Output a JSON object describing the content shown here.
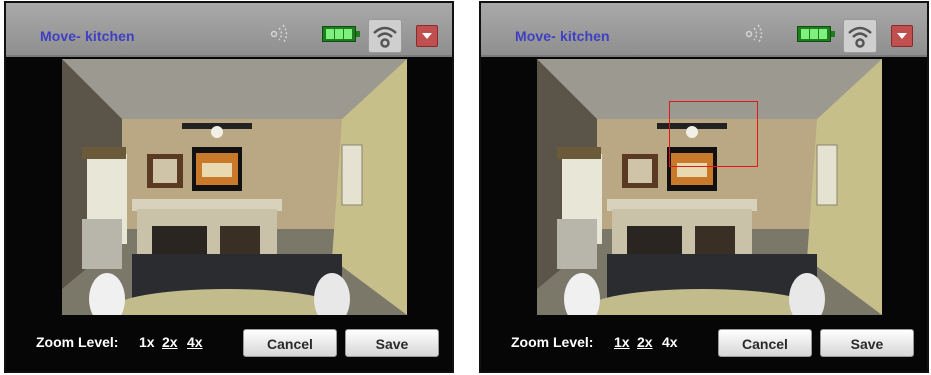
{
  "panels": [
    {
      "camera_title": "Move- kitchen",
      "zoom": {
        "label": "Zoom Level:",
        "options": [
          {
            "text": "1x",
            "active": true
          },
          {
            "text": "2x",
            "active": false
          },
          {
            "text": "4x",
            "active": false
          }
        ]
      },
      "buttons": {
        "cancel": "Cancel",
        "save": "Save"
      },
      "zoom_region_shown": false,
      "wifi_strength": "full",
      "battery_level": "full"
    },
    {
      "camera_title": "Move- kitchen",
      "zoom": {
        "label": "Zoom Level:",
        "options": [
          {
            "text": "1x",
            "active": false
          },
          {
            "text": "2x",
            "active": false
          },
          {
            "text": "4x",
            "active": true
          }
        ]
      },
      "buttons": {
        "cancel": "Cancel",
        "save": "Save"
      },
      "zoom_region_shown": true,
      "wifi_strength": "full",
      "battery_level": "full"
    }
  ],
  "colors": {
    "title_text": "#3f3fc3",
    "titlebar": "#9e9e9e",
    "frame": "#060606",
    "battery": "#1f7d1f",
    "zoom_box": "#e01818"
  },
  "icons": [
    "motion-icon",
    "battery-icon",
    "wifi-icon",
    "dropdown-icon"
  ]
}
